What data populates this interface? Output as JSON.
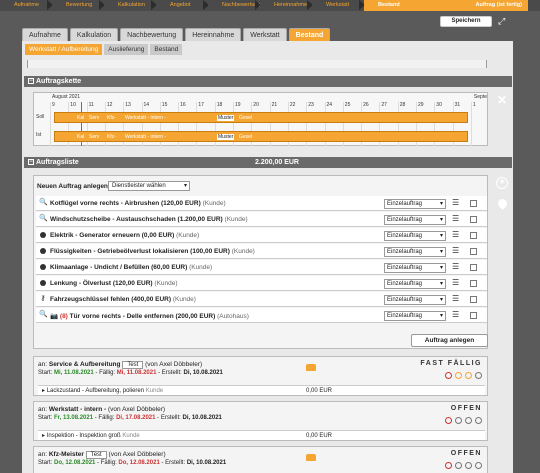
{
  "steps": [
    "Aufnahme",
    "Bewertung",
    "Kalkulation",
    "Angebot",
    "Nachbewertung",
    "Hereinnahme",
    "Werkstatt",
    "Bestand"
  ],
  "final_step": "Auftrag (ist fertig)",
  "save_label": "Speichern",
  "main_tabs": [
    "Aufnahme",
    "Kalkulation",
    "Nachbewertung",
    "Hereinnahme",
    "Werkstatt",
    "Bestand"
  ],
  "sub_tabs": [
    "Werkstatt / Aufbereitung",
    "Auslieferung",
    "Bestand"
  ],
  "auftragskette": {
    "title": "Auftragskette",
    "month": "August 2021",
    "sep": "Septe",
    "days": [
      "9",
      "10",
      "11",
      "12",
      "13",
      "14",
      "15",
      "16",
      "17",
      "18",
      "19",
      "20",
      "21",
      "22",
      "23",
      "24",
      "25",
      "26",
      "27",
      "28",
      "29",
      "30",
      "31",
      "1"
    ],
    "rows": [
      "Soll",
      "Ist"
    ],
    "chips": [
      "Kal",
      "Serv",
      "Kfz-",
      "Werkstatt - intern -"
    ],
    "muster": "Muster",
    "muster_suffix": "Gesel"
  },
  "auftragsliste": {
    "title": "Auftragsliste",
    "total": "2.200,00 EUR",
    "new_label": "Neuen Auftrag anlegen:",
    "new_select": "Dienstleister wählen",
    "items": [
      {
        "icon": "search",
        "name": "Kotflügel vorne rechts - Airbrushen (120,00 EUR)",
        "who": "(Kunde)",
        "type": "Einzelauftrag"
      },
      {
        "icon": "search",
        "name": "Windschutzscheibe - Austauschschaden (1.200,00 EUR)",
        "who": "(Kunde)",
        "type": "Einzelauftrag"
      },
      {
        "icon": "dot",
        "name": "Elektrik - Generator erneuern (0,00 EUR)",
        "who": "(Kunde)",
        "type": "Einzelauftrag"
      },
      {
        "icon": "dot",
        "name": "Flüssigkeiten - Getriebeölverlust lokalisieren (100,00 EUR)",
        "who": "(Kunde)",
        "type": "Einzelauftrag"
      },
      {
        "icon": "dot",
        "name": "Klimaanlage - Undicht / Befüllen (60,00 EUR)",
        "who": "(Kunde)",
        "type": "Einzelauftrag"
      },
      {
        "icon": "dot",
        "name": "Lenkung - Ölverlust (120,00 EUR)",
        "who": "(Kunde)",
        "type": "Einzelauftrag"
      },
      {
        "icon": "key",
        "name": "Fahrzeugschlüssel fehlen (400,00 EUR)",
        "who": "(Kunde)",
        "type": "Einzelauftrag"
      },
      {
        "icon": "search-camera",
        "prefix": "(8)",
        "name": "Tür vorne rechts - Delle entfernen (200,00 EUR)",
        "who": "(Autohaus)",
        "type": "Einzelauftrag"
      }
    ],
    "create_label": "Auftrag anlegen"
  },
  "cards": [
    {
      "an": "an:",
      "name": "Service & Aufbereitung",
      "tag": "Test",
      "from": "(von Axel Döbbeler)",
      "start_label": "Start:",
      "start": "Mi, 11.08.2021",
      "due_label": "Fällig:",
      "due": "Mi, 11.08.2021",
      "created_label": "Erstellt:",
      "created": "Di, 10.08.2021",
      "status": "FAST FÄLLIG",
      "sub": "Lackzustand - Aufbereitung, polieren",
      "sub_who": "Kunde",
      "amount": "0,00 EUR"
    },
    {
      "an": "an:",
      "name": "Werkstatt - intern -",
      "tag": "",
      "from": "(von Axel Döbbeler)",
      "start_label": "Start:",
      "start": "Fr, 13.08.2021",
      "due_label": "Fällig:",
      "due": "Di, 17.08.2021",
      "created_label": "Erstellt:",
      "created": "Di, 10.08.2021",
      "status": "OFFEN",
      "sub": "Inspektion - Inspektion groß",
      "sub_who": "Kunde",
      "amount": "0,00 EUR"
    },
    {
      "an": "an:",
      "name": "Kfz-Meister",
      "tag": "Test",
      "from": "(von Axel Döbbeler)",
      "start_label": "Start:",
      "start": "Do, 12.08.2021",
      "due_label": "Fällig:",
      "due": "Do, 12.08.2021",
      "created_label": "Erstellt:",
      "created": "Di, 10.08.2021",
      "status": "OFFEN"
    }
  ]
}
